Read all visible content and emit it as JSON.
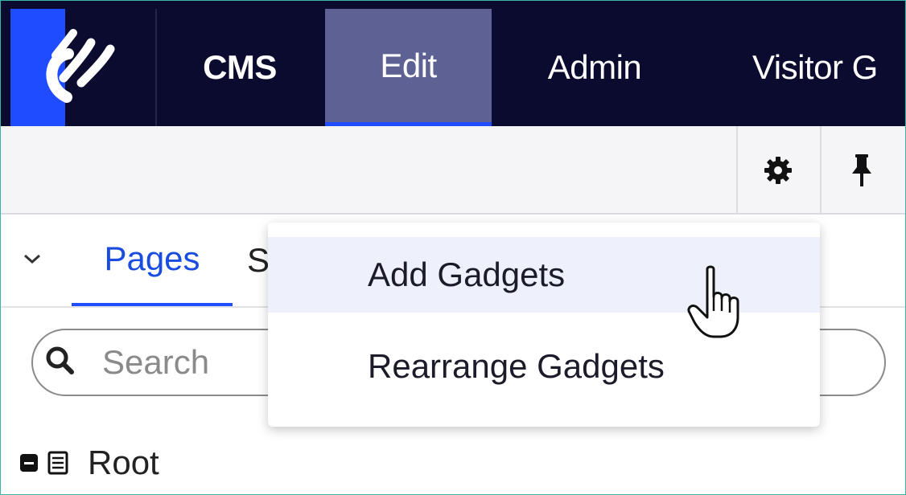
{
  "topnav": {
    "items": [
      {
        "label": "CMS",
        "active": false
      },
      {
        "label": "Edit",
        "active": true
      },
      {
        "label": "Admin",
        "active": false
      },
      {
        "label": "Visitor G",
        "active": false
      }
    ],
    "brand_color": "#1f4cff",
    "background": "#0b0b2f",
    "active_background": "#5e6194"
  },
  "toolbar": {
    "icons": [
      "gear-icon",
      "pin-icon"
    ]
  },
  "panel": {
    "tabs": [
      {
        "label": "Pages",
        "active": true
      },
      {
        "label": "S",
        "active": false
      }
    ],
    "search": {
      "placeholder": "Search",
      "value": ""
    },
    "tree": {
      "items": [
        {
          "label": "Root",
          "expanded": true
        }
      ]
    }
  },
  "menu": {
    "items": [
      {
        "label": "Add Gadgets",
        "hovered": true
      },
      {
        "label": "Rearrange Gadgets",
        "hovered": false
      }
    ]
  },
  "colors": {
    "accent": "#1f4cff",
    "link": "#1a4ce0",
    "frame_border": "#39b6a6"
  }
}
